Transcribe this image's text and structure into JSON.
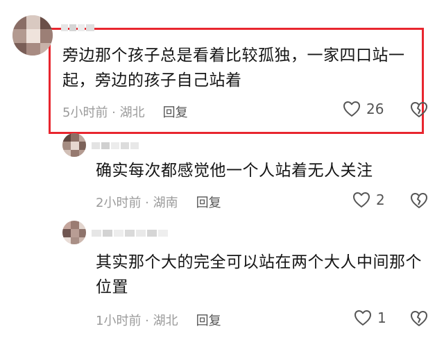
{
  "comments": [
    {
      "text": "旁边那个孩子总是看着比较孤独，一家四口站一起，旁边的孩子自己站着",
      "time": "5小时前",
      "location": "湖北",
      "reply_label": "回复",
      "likes": "26"
    },
    {
      "text": "确实每次都感觉他一个人站着无人关注",
      "time": "2小时前",
      "location": "湖南",
      "reply_label": "回复",
      "likes": "2"
    },
    {
      "text": "其实那个大的完全可以站在两个大人中间那个位置",
      "time": "1小时前",
      "location": "湖北",
      "reply_label": "回复",
      "likes": "1"
    }
  ],
  "separator": " · ",
  "colors": {
    "highlight": "#e8262f",
    "meta": "#9b9b9b",
    "text": "#151515"
  },
  "icons": [
    "heart-outline-icon",
    "broken-heart-icon"
  ]
}
